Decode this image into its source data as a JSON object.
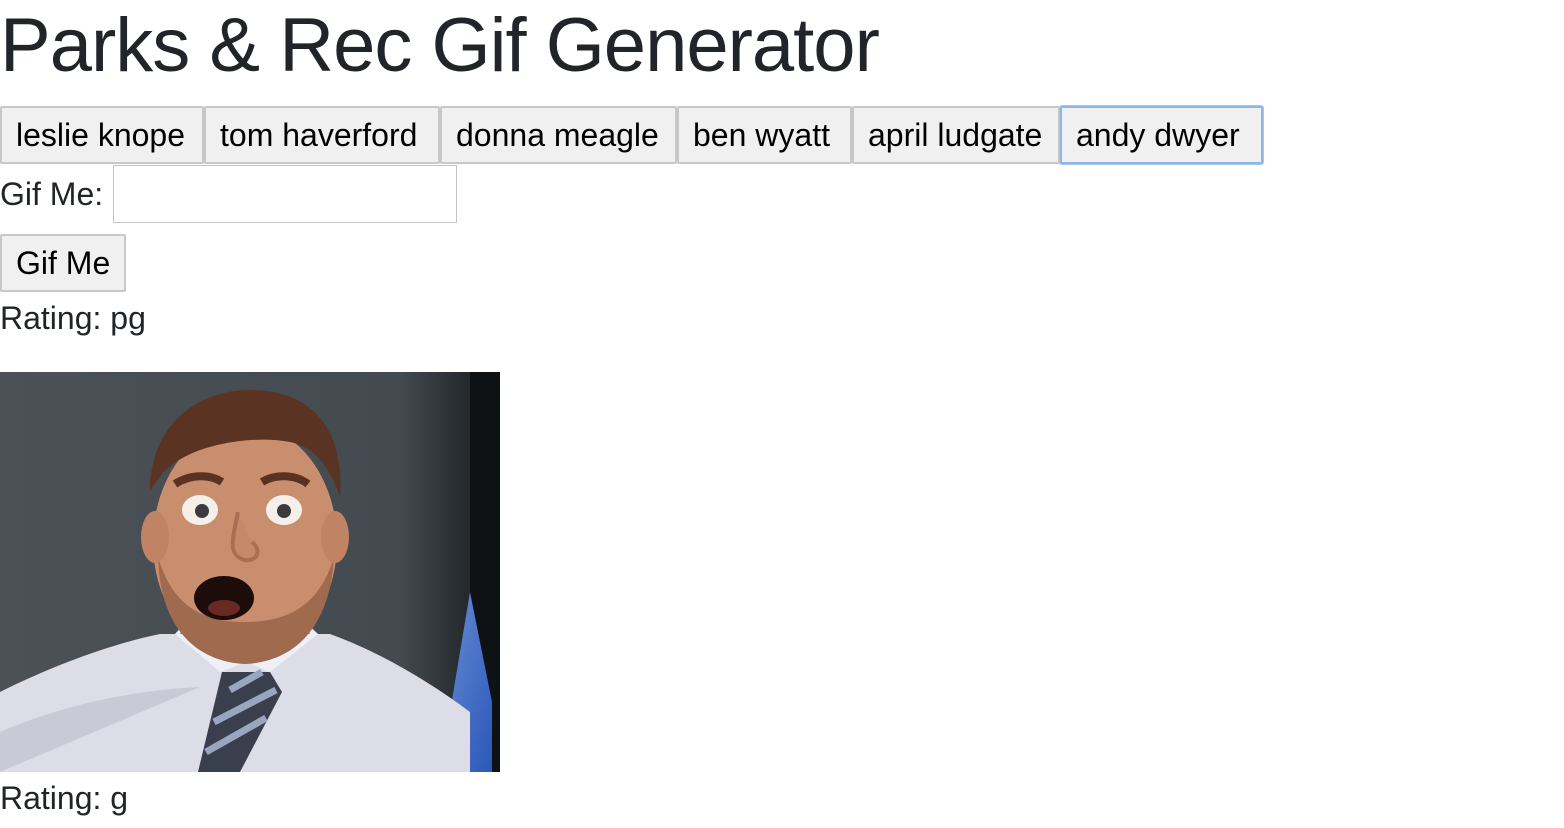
{
  "page": {
    "title": "Parks & Rec Gif Generator"
  },
  "characters": [
    {
      "label": "leslie knope"
    },
    {
      "label": "tom haverford"
    },
    {
      "label": "donna meagle"
    },
    {
      "label": "ben wyatt"
    },
    {
      "label": "april ludgate"
    },
    {
      "label": "andy dwyer",
      "focused": true
    }
  ],
  "search": {
    "label": "Gif Me:",
    "value": "",
    "placeholder": "",
    "submit_label": "Gif Me"
  },
  "results": [
    {
      "rating": "Rating: pg"
    },
    {
      "rating": "Rating: g"
    }
  ]
}
